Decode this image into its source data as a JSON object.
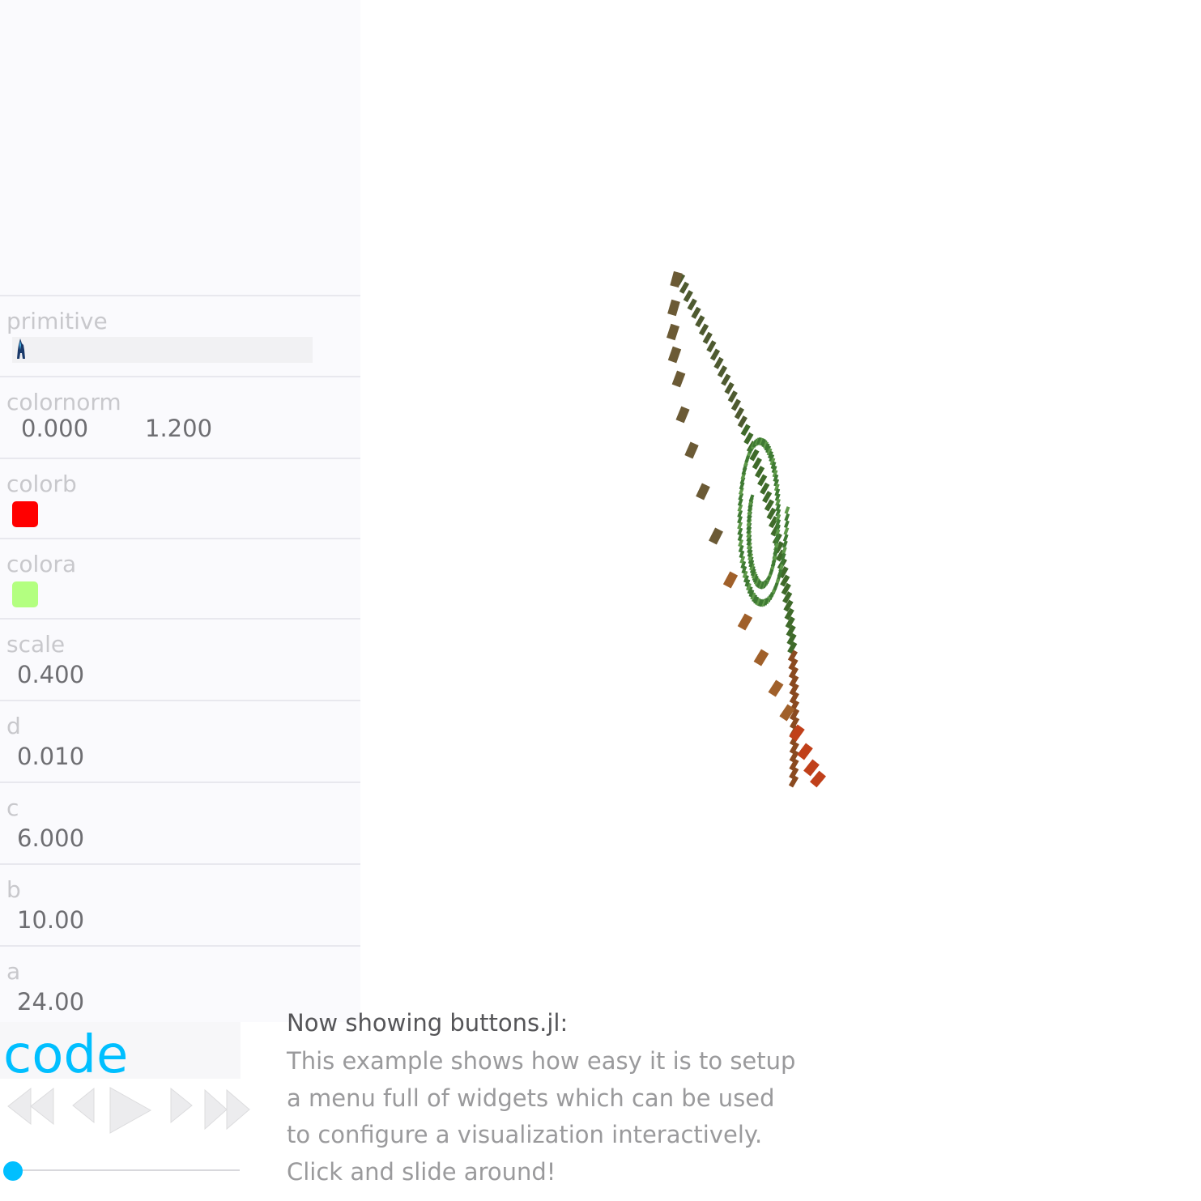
{
  "panel": {
    "rows": [
      {
        "label": "primitive"
      },
      {
        "label": "colornorm",
        "min": "0.000",
        "max": "1.200"
      },
      {
        "label": "colorb",
        "color": "#ff0000"
      },
      {
        "label": "colora",
        "color": "#b3ff80"
      },
      {
        "label": "scale",
        "value": "0.400"
      },
      {
        "label": "d",
        "value": "0.010"
      },
      {
        "label": "c",
        "value": "6.000"
      },
      {
        "label": "b",
        "value": "10.00"
      },
      {
        "label": "a",
        "value": "24.00"
      }
    ]
  },
  "player": {
    "code_label": "code",
    "controls": [
      "skip-to-start-icon",
      "step-back-icon",
      "play-icon",
      "step-forward-icon",
      "skip-to-end-icon"
    ],
    "progress": 0.0
  },
  "description": {
    "title": "Now showing buttons.jl:",
    "lines": [
      "This example shows how easy it is to setup",
      "a menu full of widgets which can be used",
      "to configure a visualization interactively.",
      "Click and slide around!"
    ]
  },
  "colors": {
    "accent": "#00bfff",
    "swatch_b": "#ff0000",
    "swatch_a": "#b3ff80"
  }
}
